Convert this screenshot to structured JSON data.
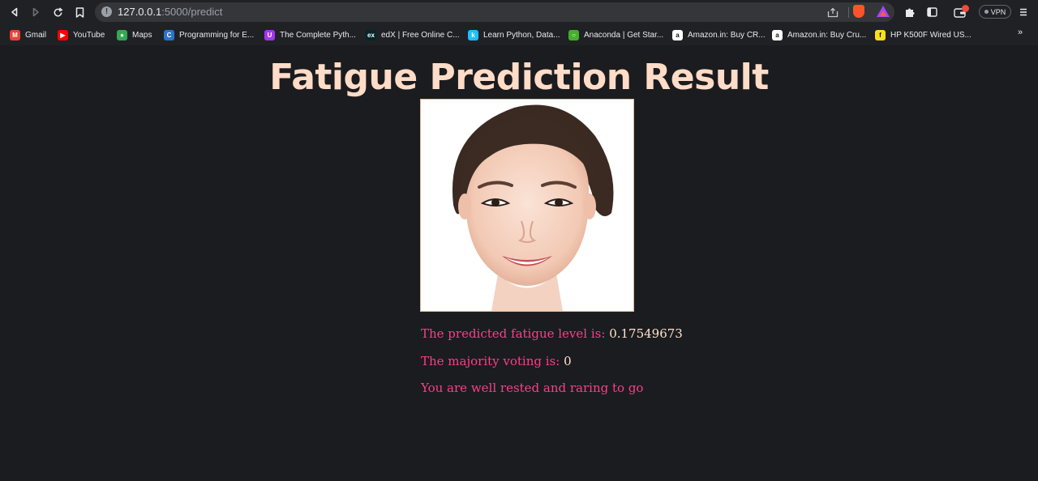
{
  "browser": {
    "url_host": "127.0.0.1",
    "url_path": ":5000/predict",
    "vpn_label": "VPN",
    "icons": {
      "back": "back-icon",
      "forward": "forward-icon",
      "reload": "reload-icon",
      "bookmark": "bookmark-icon",
      "site_info": "info-icon",
      "share": "share-icon",
      "brave": "brave-shield-icon",
      "rewards": "brave-rewards-icon",
      "extensions": "puzzle-icon",
      "sidebar": "sidebar-icon",
      "wallet": "wallet-icon",
      "menu": "menu-icon"
    }
  },
  "bookmarks": [
    {
      "label": "Gmail",
      "icon": "gmail-icon",
      "color": "#ea4335",
      "glyph": "M"
    },
    {
      "label": "YouTube",
      "icon": "youtube-icon",
      "color": "#ff0000",
      "glyph": "▶"
    },
    {
      "label": "Maps",
      "icon": "maps-icon",
      "color": "#34a853",
      "glyph": "●"
    },
    {
      "label": "Programming for E...",
      "icon": "coursera-icon",
      "color": "#2a73cc",
      "glyph": "C"
    },
    {
      "label": "The Complete Pyth...",
      "icon": "udemy-icon",
      "color": "#a435f0",
      "glyph": "U"
    },
    {
      "label": "edX | Free Online C...",
      "icon": "edx-icon",
      "color": "#02262b",
      "glyph": "ex"
    },
    {
      "label": "Learn Python, Data...",
      "icon": "kaggle-icon",
      "color": "#20beff",
      "glyph": "k"
    },
    {
      "label": "Anaconda | Get Star...",
      "icon": "anaconda-icon",
      "color": "#43b02a",
      "glyph": "○"
    },
    {
      "label": "Amazon.in: Buy CR...",
      "icon": "amazon-icon",
      "color": "#ffffff",
      "glyph": "a"
    },
    {
      "label": "Amazon.in: Buy Cru...",
      "icon": "amazon-icon",
      "color": "#ffffff",
      "glyph": "a"
    },
    {
      "label": "HP K500F Wired US...",
      "icon": "flipkart-icon",
      "color": "#f8e11a",
      "glyph": "f"
    }
  ],
  "bookmarks_overflow": "»",
  "page": {
    "title": "Fatigue Prediction Result",
    "image_alt": "uploaded face photo",
    "fatigue_label": "The predicted fatigue level is:",
    "fatigue_value": "0.17549673",
    "voting_label": "The majority voting is:",
    "voting_value": "0",
    "message": "You are well rested and raring to go"
  },
  "colors": {
    "background": "#1b1c1f",
    "title": "#ffdcc7",
    "label": "#ff3d8b",
    "value": "#ffe3cc"
  }
}
